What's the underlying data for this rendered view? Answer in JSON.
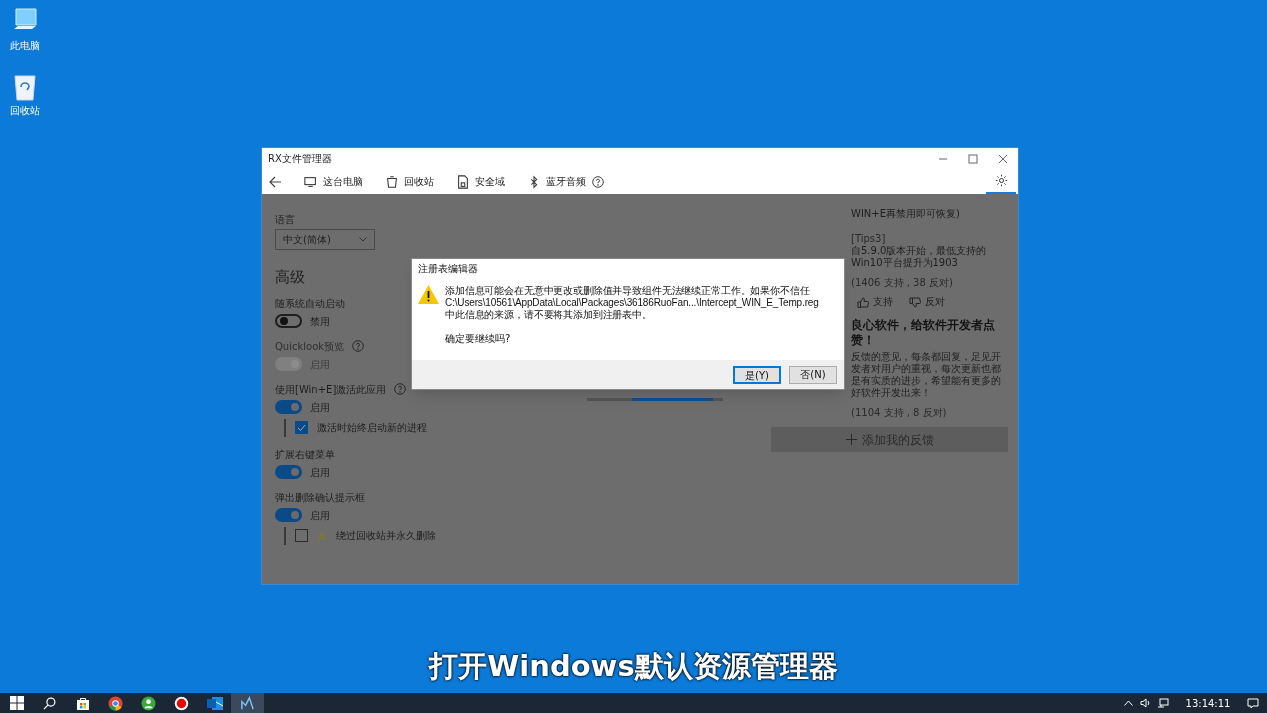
{
  "desktop_icons": [
    {
      "kind": "computer",
      "label": "此电脑"
    },
    {
      "kind": "recycle",
      "label": "回收站"
    }
  ],
  "window": {
    "title": "RX文件管理器",
    "toolbar": [
      {
        "kind": "pc",
        "label": "这台电脑"
      },
      {
        "kind": "recycle",
        "label": "回收站"
      },
      {
        "kind": "lock",
        "label": "安全域"
      },
      {
        "kind": "bluetooth",
        "label": "蓝牙音频",
        "help": true
      }
    ]
  },
  "settings": {
    "language_label": "语言",
    "language_value": "中文(简体)",
    "section_title": "高级",
    "items": [
      {
        "label": "随系统自动启动",
        "on": false,
        "disabled": false,
        "state_label": "禁用"
      },
      {
        "label": "Quicklook预览",
        "help": true,
        "on": true,
        "disabled": true,
        "state_label": "启用"
      },
      {
        "label": "使用[Win+E]激活此应用",
        "help": true,
        "on": true,
        "disabled": false,
        "state_label": "启用",
        "sub": {
          "label": "激活时始终启动新的进程",
          "checked": true
        }
      },
      {
        "label": "扩展右键菜单",
        "on": true,
        "disabled": false,
        "state_label": "启用"
      },
      {
        "label": "弹出删除确认提示框",
        "on": true,
        "disabled": false,
        "state_label": "启用",
        "sub": {
          "label": "绕过回收站并永久删除",
          "checked": false,
          "warning": true
        }
      }
    ]
  },
  "feedback": {
    "intro": "WIN+E再禁用即可恢复)",
    "tip_title": "[Tips3]",
    "tip_body": "自5.9.0版本开始，最低支持的Win10平台提升为1903",
    "tip_votes": "(1406 支持 , 38 反对)",
    "support": "支持",
    "oppose": "反对",
    "heading": "良心软件，给软件开发者点赞！",
    "body": "反馈的意见，每条都回复，足见开发者对用户的重视，每次更新也都是有实质的进步，希望能有更多的好软件开发出来！",
    "votes": "(1104 支持 , 8 反对)",
    "add_button": "添加我的反馈"
  },
  "dialog": {
    "title": "注册表编辑器",
    "message": [
      "添加信息可能会在无意中更改或删除值并导致组件无法继续正常工作。如果你不信任",
      "C:\\Users\\10561\\AppData\\Local\\Packages\\36186RuoFan...\\Intercept_WIN_E_Temp.reg",
      "中此信息的来源，请不要将其添加到注册表中。"
    ],
    "question": "确定要继续吗?",
    "buttons": [
      {
        "label": "是(Y)",
        "selected": true
      },
      {
        "label": "否(N)",
        "selected": false
      }
    ]
  },
  "subtitle": "打开Windows默认资源管理器",
  "taskbar": {
    "apps": [
      {
        "kind": "start",
        "selected": false
      },
      {
        "kind": "search",
        "selected": false
      },
      {
        "kind": "store",
        "selected": false
      },
      {
        "kind": "chrome",
        "selected": false
      },
      {
        "kind": "green",
        "selected": false
      },
      {
        "kind": "record",
        "selected": false
      },
      {
        "kind": "mail",
        "selected": false
      },
      {
        "kind": "rx",
        "selected": true
      }
    ],
    "time": "13:14:11"
  }
}
